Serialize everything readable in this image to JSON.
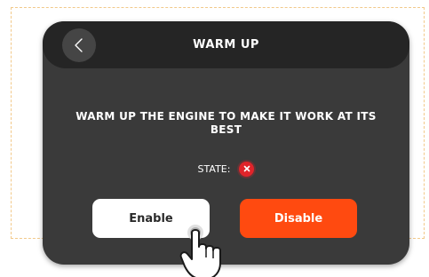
{
  "header": {
    "title": "WARM UP",
    "back_icon": "chevron-left-icon"
  },
  "message": "WARM UP THE ENGINE TO MAKE IT WORK AT ITS BEST",
  "state": {
    "label": "STATE:",
    "icon": "x-icon",
    "color": "#e0242a"
  },
  "buttons": {
    "enable_label": "Enable",
    "disable_label": "Disable",
    "disable_color": "#ff4a10"
  },
  "overlay": {
    "pointer_icon": "hand-pointer-icon"
  },
  "colors": {
    "screen_bg": "#3a3a3a",
    "header_bg": "#252525",
    "frame_border": "#f2c98a"
  }
}
